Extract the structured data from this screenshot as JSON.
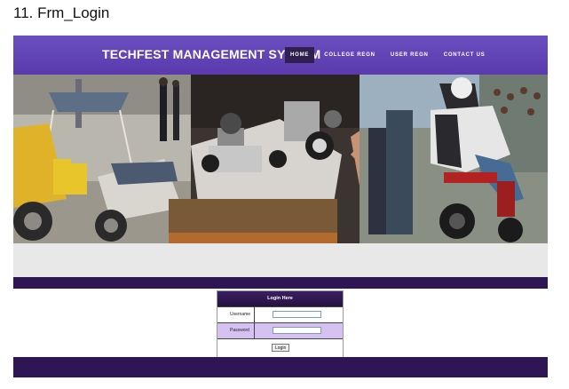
{
  "document": {
    "caption": "11. Frm_Login"
  },
  "header": {
    "site_title": "TECHFEST MANAGEMENT SYSTEM",
    "nav": [
      {
        "label": "HOME",
        "active": true
      },
      {
        "label": "COLLEGE REGN",
        "active": false
      },
      {
        "label": "USER REGN",
        "active": false
      },
      {
        "label": "CONTACT US",
        "active": false
      }
    ]
  },
  "login": {
    "title": "Login Here",
    "username_label": "Username",
    "password_label": "Password",
    "username_value": "",
    "password_value": "",
    "button_label": "Login"
  },
  "colors": {
    "header_purple": "#5a3aad",
    "band_dark_purple": "#2d1653",
    "row_lavender": "#d6c2f2"
  }
}
